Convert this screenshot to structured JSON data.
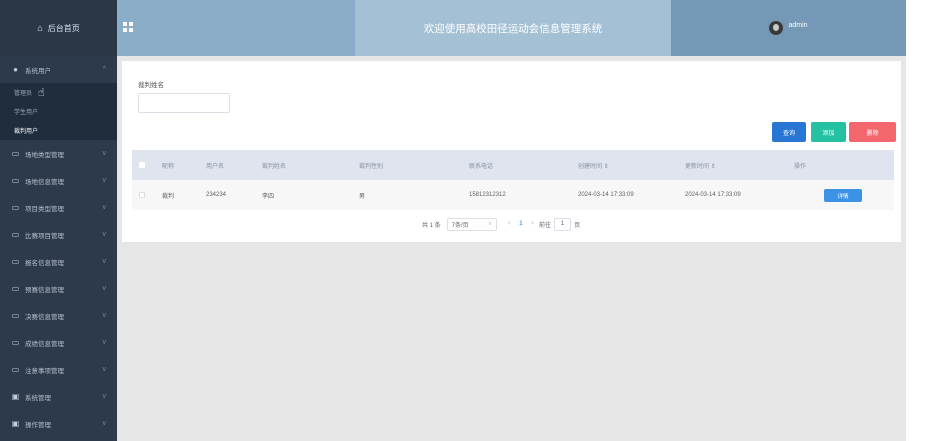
{
  "sidebar": {
    "home_label": "后台首页",
    "system_user": {
      "label": "系统用户",
      "icon": "user-icon"
    },
    "sub_items": [
      {
        "label": "管理员",
        "active": false
      },
      {
        "label": "学生用户",
        "active": false
      },
      {
        "label": "裁判用户",
        "active": true
      }
    ],
    "menu_items": [
      {
        "label": "场地类型管理"
      },
      {
        "label": "场地信息管理"
      },
      {
        "label": "项目类型管理"
      },
      {
        "label": "比赛项目管理"
      },
      {
        "label": "报名信息管理"
      },
      {
        "label": "预赛信息管理"
      },
      {
        "label": "决赛信息管理"
      },
      {
        "label": "成绩信息管理"
      },
      {
        "label": "注意事项管理"
      },
      {
        "label": "系统管理"
      },
      {
        "label": "操作管理"
      }
    ]
  },
  "header": {
    "title": "欢迎使用高校田径运动会信息管理系统",
    "username": "admin"
  },
  "search": {
    "label": "裁判姓名",
    "value": ""
  },
  "actions": {
    "query": "查询",
    "add": "添加",
    "delete": "删除"
  },
  "table": {
    "columns": [
      "昵称",
      "用户名",
      "裁判姓名",
      "裁判性别",
      "联系电话",
      "创建时间 ⇕",
      "更新时间 ⇕",
      "操作"
    ],
    "rows": [
      {
        "nickname": "裁判",
        "username": "234234",
        "name": "李四",
        "gender": "男",
        "phone": "15812312312",
        "created": "2024-03-14 17:33:09",
        "updated": "2024-03-14 17:33:09",
        "action": "详情"
      }
    ]
  },
  "pagination": {
    "total": "共 1 条",
    "page_size": "7条/页",
    "current_page": "1",
    "goto_prefix": "前往",
    "goto_value": "1",
    "goto_suffix": "页"
  },
  "colors": {
    "sidebar_bg": "#2d3a4b",
    "header_bg": "#8cadc7",
    "query_button": "#2776d6",
    "add_button": "#24c1a3",
    "delete_button": "#f2676d",
    "detail_button": "#3c93e6"
  }
}
